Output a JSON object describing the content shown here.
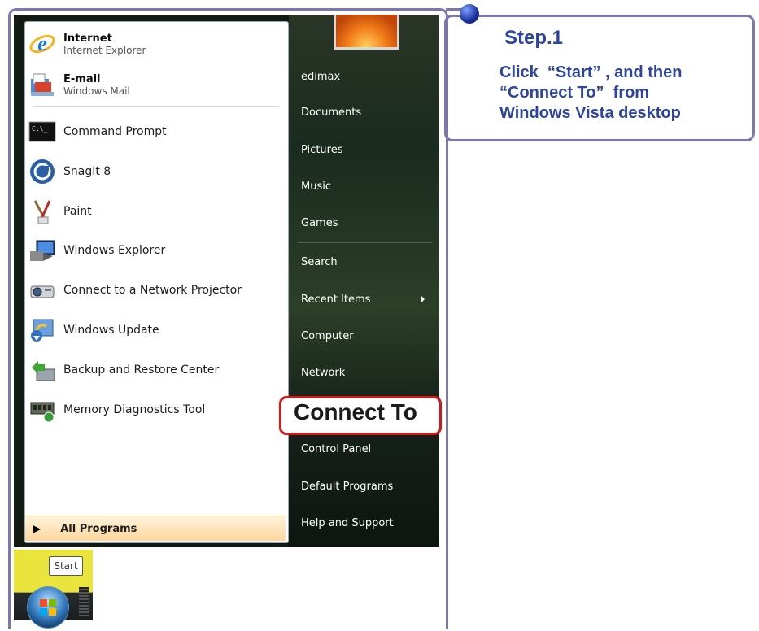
{
  "callout": {
    "title": "Step.1",
    "lines": [
      "Click  “Start” , and then",
      "“Connect To”  from",
      "Windows Vista desktop"
    ]
  },
  "start_menu": {
    "pinned": [
      {
        "title": "Internet",
        "subtitle": "Internet Explorer",
        "icon": "ie-icon"
      },
      {
        "title": "E-mail",
        "subtitle": "Windows Mail",
        "icon": "mail-icon"
      }
    ],
    "recent": [
      {
        "label": "Command Prompt",
        "icon": "cmd-icon"
      },
      {
        "label": "SnagIt 8",
        "icon": "snagit-icon"
      },
      {
        "label": "Paint",
        "icon": "paint-icon"
      },
      {
        "label": "Windows Explorer",
        "icon": "explorer-icon"
      },
      {
        "label": "Connect to a Network Projector",
        "icon": "projector-icon"
      },
      {
        "label": "Windows Update",
        "icon": "update-icon"
      },
      {
        "label": "Backup and Restore Center",
        "icon": "backup-icon"
      },
      {
        "label": "Memory Diagnostics Tool",
        "icon": "memory-icon"
      }
    ],
    "all_programs": "All Programs",
    "right": {
      "user": "edimax",
      "items1": [
        "Documents",
        "Pictures",
        "Music",
        "Games"
      ],
      "items2": [
        "Search",
        "Recent Items",
        "Computer",
        "Network"
      ],
      "connect_to": "Connect To",
      "items3": [
        "Control Panel",
        "Default Programs",
        "Help and Support"
      ]
    }
  },
  "taskbar": {
    "start_tooltip": "Start"
  },
  "colors": {
    "callout_text": "#2c45a2",
    "highlight_border": "#d21818",
    "frame": "#7b78b0"
  }
}
